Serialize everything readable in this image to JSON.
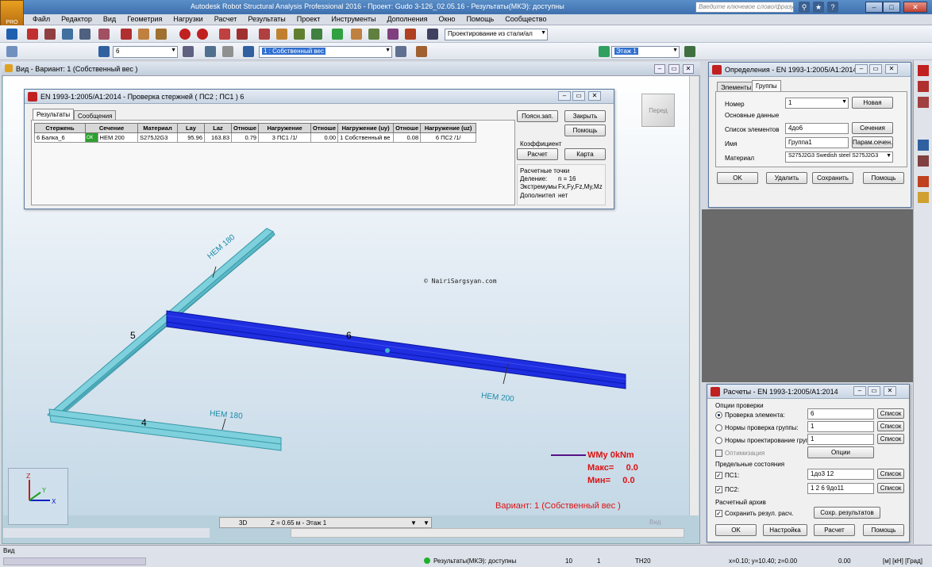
{
  "app": {
    "title": "Autodesk Robot Structural Analysis Professional 2016 - Проект: Gudo 3-126_02.05.16 - Результаты(МКЭ): доступны",
    "logo_label": "PRO",
    "search_placeholder": "Введите ключевое слово/фразу"
  },
  "menu": [
    "Файл",
    "Редактор",
    "Вид",
    "Геометрия",
    "Нагрузки",
    "Расчет",
    "Результаты",
    "Проект",
    "Инструменты",
    "Дополнения",
    "Окно",
    "Помощь",
    "Сообщество"
  ],
  "toolbar": {
    "layout_combo": "Проектирование из стали/ал",
    "bar_number": "6",
    "load_case": "1 : Собственный вес",
    "story_combo": "Этаж 1"
  },
  "view": {
    "title": "Вид - Вариант: 1 (Собственный вес )",
    "cube_label": "Перед",
    "copyright": "© NairiSargsyan.com",
    "members": [
      {
        "number": "5",
        "section": "HEM 180"
      },
      {
        "number": "6",
        "section": "HEM 200"
      },
      {
        "number": "4",
        "section": "HEM 180"
      }
    ],
    "legend": {
      "label": "WMy  0kNm",
      "max": "Макс=     0.0",
      "min": "Мин=     0.0",
      "color": "#dd1111",
      "line_color": "#551188"
    },
    "variant": "Вариант: 1 (Собственный вес )",
    "nav_mode": "3D",
    "nav_level": "Z = 0.65 м - Этаж 1",
    "vid_label": "Вид"
  },
  "check_dialog": {
    "title": "EN 1993-1:2005/A1:2014 - Проверка стержней ( ПС2 ; ПС1 ) 6",
    "tabs": [
      "Результаты",
      "Сообщения"
    ],
    "columns": [
      "Стержень",
      "Сечение",
      "Материал",
      "Lay",
      "Laz",
      "Отноше",
      "Нагружение",
      "Отноше",
      "Нагружение (uy)",
      "Отноше",
      "Нагружение (uz)"
    ],
    "row": {
      "bar": "6  Балка_6",
      "ok": "ОК",
      "section": "HEM 200",
      "material": "S275J2G3",
      "lay": "95.96",
      "laz": "163.83",
      "ratio1": "0.79",
      "load1": "3 ПС1 /1/",
      "ratio2": "0.00",
      "load2": "1 Собственный ве",
      "ratio3": "0.08",
      "load3": "6 ПС2 /1/"
    },
    "buttons": {
      "notes": "Поясн.зап.",
      "close": "Закрыть",
      "help": "Помощь",
      "calc": "Расчет",
      "map": "Карта"
    },
    "coef_label": "Коэффициент",
    "calc_points": "Расчетные точки",
    "division": "Деление:",
    "division_val": "n = 16",
    "extremes": "Экстремумы",
    "extremes_val": "Fx,Fy,Fz,My,Mz",
    "additional": "Дополнител",
    "additional_val": "нет"
  },
  "definitions_dialog": {
    "title": "Определения - EN 1993-1:2005/A1:2014",
    "tabs": [
      "Элементы",
      "Группы"
    ],
    "number_label": "Номер",
    "number_val": "1",
    "new_btn": "Новая",
    "main_data": "Основные данные",
    "elements_label": "Список элементов",
    "elements_val": "4до6",
    "sections_btn": "Сечения",
    "name_label": "Имя",
    "name_val": "Группа1",
    "params_btn": "Парам.сечен.",
    "material_label": "Материал",
    "material_val": "S275J2G3 Swedish steel S275J2G3",
    "buttons": {
      "ok": "OK",
      "delete": "Удалить",
      "save": "Сохранить",
      "help": "Помощь"
    }
  },
  "calc_dialog": {
    "title": "Расчеты - EN 1993-1:2005/A1:2014",
    "options_label": "Опции проверки",
    "opt1": "Проверка элемента:",
    "opt1_val": "6",
    "opt2": "Нормы проверка группы:",
    "opt2_val": "1",
    "opt3": "Нормы проектирование груп",
    "opt3_val": "1",
    "list_btn": "Список",
    "optimization": "Оптимизация",
    "options_btn": "Опции",
    "limit_states": "Предельные состояния",
    "ps1_label": "ПС1:",
    "ps1_val": "1до3 12",
    "ps2_label": "ПС2:",
    "ps2_val": "1 2 6 9до11",
    "archive_label": "Расчетный архив",
    "save_results": "Сохранить резул. расч.",
    "save_results_btn": "Сохр. результатов",
    "buttons": {
      "ok": "OK",
      "settings": "Настройка",
      "calc": "Расчет",
      "help": "Помощь"
    }
  },
  "status": {
    "left_label": "Вид",
    "results": "Результаты(МКЭ): доступны",
    "n1": "10",
    "n2": "1",
    "section": "TH20",
    "coords": "x=0.10; y=10.40; z=0.00",
    "value": "0.00",
    "units": "[м] [кН] [Град]"
  }
}
